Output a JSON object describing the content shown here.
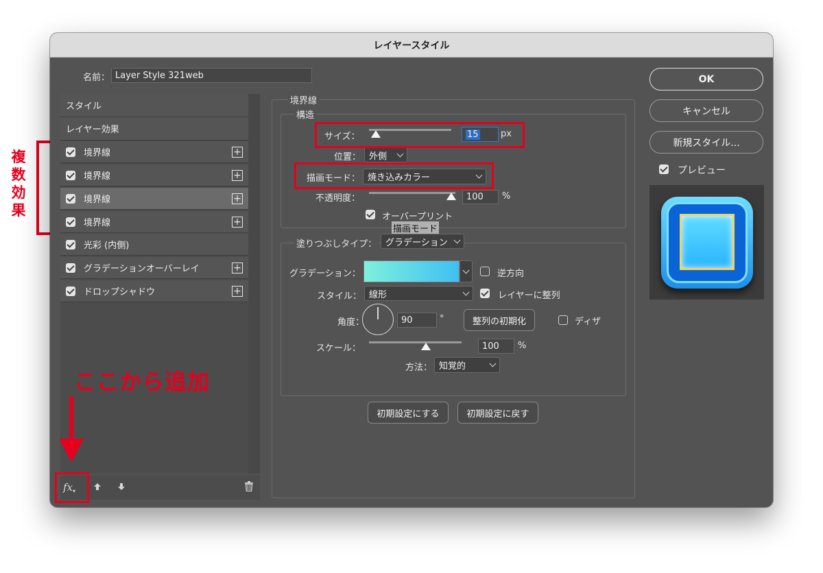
{
  "window": {
    "title": "レイヤースタイル"
  },
  "name_field": {
    "label": "名前：",
    "value": "Layer Style 321web"
  },
  "styles_list": {
    "header_styles": "スタイル",
    "header_effects": "レイヤー効果",
    "items": [
      {
        "label": "境界線",
        "checked": true,
        "plus": true
      },
      {
        "label": "境界線",
        "checked": true,
        "plus": true
      },
      {
        "label": "境界線",
        "checked": true,
        "plus": true,
        "selected": true
      },
      {
        "label": "境界線",
        "checked": true,
        "plus": true
      },
      {
        "label": "光彩 (内側)",
        "checked": true,
        "plus": false
      },
      {
        "label": "グラデーションオーバーレイ",
        "checked": true,
        "plus": true
      },
      {
        "label": "ドロップシャドウ",
        "checked": true,
        "plus": true
      }
    ]
  },
  "bottom_bar": {
    "fx_label": "fx"
  },
  "panel": {
    "section_title": "境界線",
    "structure_title": "構造",
    "size_label": "サイズ：",
    "size_value": "15",
    "size_unit": "px",
    "size_level": 0.08,
    "position_label": "位置：",
    "position_value": "外側",
    "blend_label": "描画モード：",
    "blend_value": "焼き込みカラー",
    "opacity_label": "不透明度：",
    "opacity_value": "100",
    "opacity_unit": "%",
    "overprint_label": "オーバープリント",
    "tooltip_text": "描画モード",
    "fill_type_label": "塗りつぶしタイプ：",
    "fill_type_value": "グラデーション",
    "gradient_label": "グラデーション：",
    "reverse_label": "逆方向",
    "style_label": "スタイル：",
    "style_value": "線形",
    "align_layer_label": "レイヤーに整列",
    "angle_label": "角度：",
    "angle_value": "90",
    "angle_unit": "°",
    "reset_align_button": "整列の初期化",
    "dither_label": "ディザ",
    "scale_label": "スケール：",
    "scale_value": "100",
    "scale_unit": "%",
    "method_label": "方法：",
    "method_value": "知覚的",
    "make_default_button": "初期設定にする",
    "reset_default_button": "初期設定に戻す"
  },
  "right": {
    "ok": "OK",
    "cancel": "キャンセル",
    "new_style": "新規スタイル...",
    "preview_label": "プレビュー"
  },
  "annotations": {
    "multi_effect": [
      "複",
      "数",
      "効",
      "果"
    ],
    "add_here": "ここから追加"
  },
  "colors": {
    "accent_red": "#e6001e",
    "gradient_start": "#7ff0dc",
    "gradient_end": "#3fc0f2",
    "preview_blue": "#1aa3ff"
  }
}
